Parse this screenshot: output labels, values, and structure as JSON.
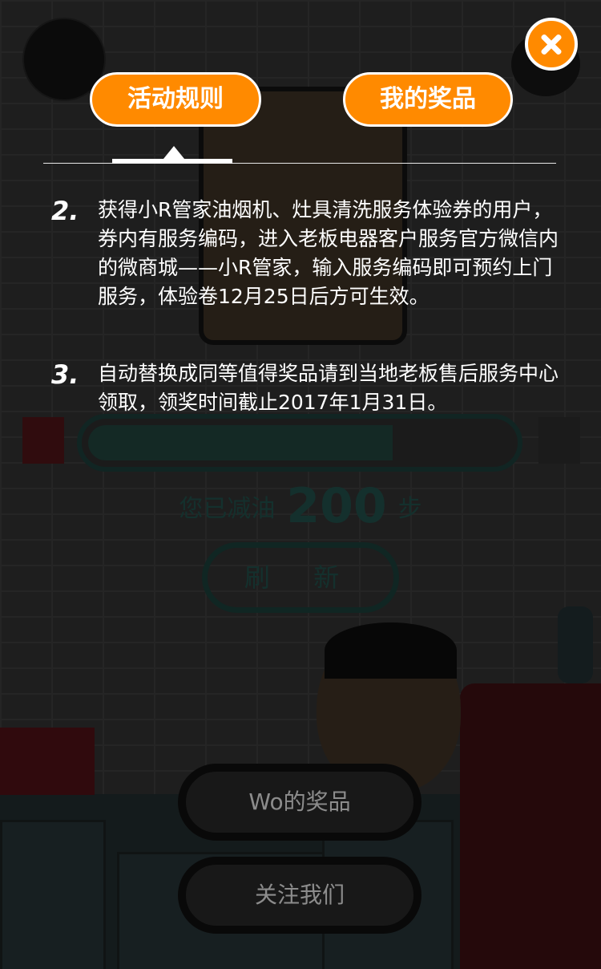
{
  "tabs": {
    "rules_label": "活动规则",
    "prizes_label": "我的奖品"
  },
  "rules": [
    {
      "num": "2.",
      "text": "获得小R管家油烟机、灶具清洗服务体验券的用户，券内有服务编码，进入老板电器客户服务官方微信内的微商城——小R管家，输入服务编码即可预约上门服务，体验卷12月25日后方可生效。"
    },
    {
      "num": "3.",
      "text": "自动替换成同等值得奖品请到当地老板售后服务中心领取，领奖时间截止2017年1月31日。"
    }
  ],
  "progress": {
    "fraction": 0.72
  },
  "reduce": {
    "prefix": "您已减油",
    "value": "200",
    "suffix": "步"
  },
  "refresh_label": "刷 新",
  "bottom_buttons": {
    "my_prizes": "Wo的奖品",
    "follow_us": "关注我们"
  },
  "colors": {
    "accent": "#ff8a00",
    "teal": "#1f4b45"
  },
  "icons": {
    "close": "close-icon",
    "gift_left": "gift-icon",
    "gift_right": "gift-icon"
  }
}
